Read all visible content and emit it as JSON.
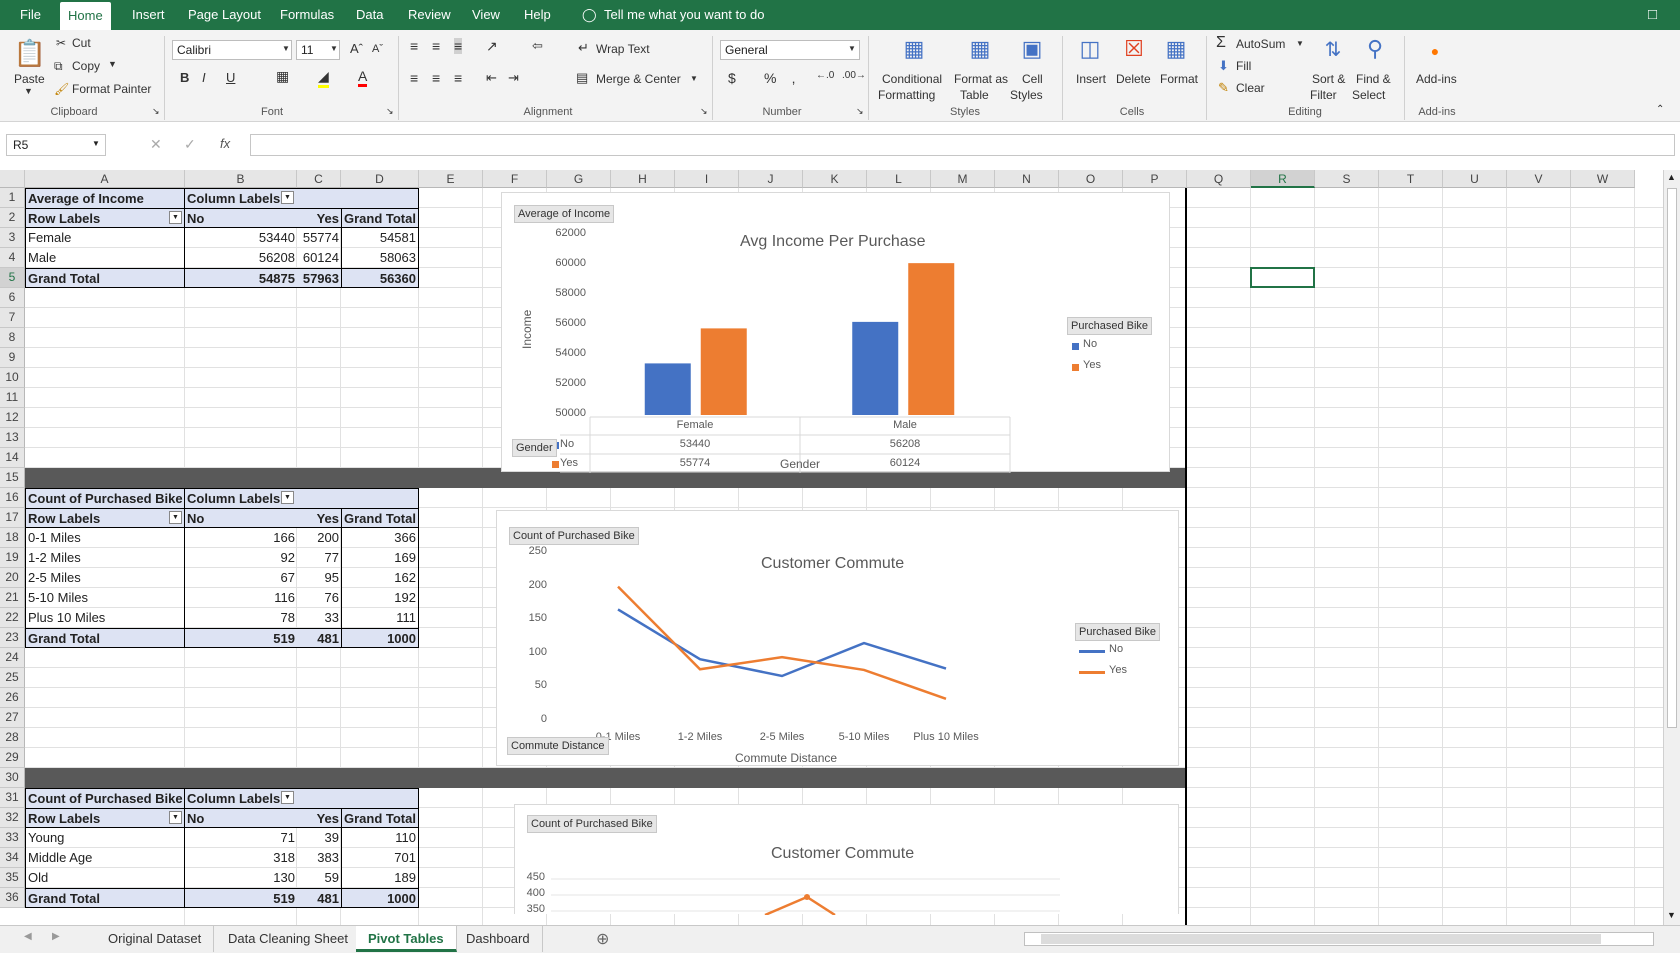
{
  "menu": {
    "items": [
      "File",
      "Home",
      "Insert",
      "Page Layout",
      "Formulas",
      "Data",
      "Review",
      "View",
      "Help"
    ],
    "tell_me": "Tell me what you want to do"
  },
  "ribbon": {
    "clipboard": {
      "paste": "Paste",
      "cut": "Cut",
      "copy": "Copy",
      "format_painter": "Format Painter",
      "group": "Clipboard"
    },
    "font": {
      "family": "Calibri",
      "size": "11",
      "group": "Font"
    },
    "alignment": {
      "wrap": "Wrap Text",
      "merge": "Merge & Center",
      "group": "Alignment"
    },
    "number": {
      "format": "General",
      "group": "Number"
    },
    "styles": {
      "conditional": "Conditional",
      "conditional2": "Formatting",
      "format_as": "Format as",
      "format_as2": "Table",
      "cell": "Cell",
      "cell2": "Styles",
      "group": "Styles"
    },
    "cells": {
      "insert": "Insert",
      "delete": "Delete",
      "format": "Format",
      "group": "Cells"
    },
    "editing": {
      "autosum": "AutoSum",
      "fill": "Fill",
      "clear": "Clear",
      "sort": "Sort &",
      "sort2": "Filter",
      "find": "Find &",
      "find2": "Select",
      "group": "Editing"
    },
    "addins": {
      "label": "Add-ins",
      "group": "Add-ins"
    }
  },
  "name_box": "R5",
  "columns": [
    "A",
    "B",
    "C",
    "D",
    "E",
    "F",
    "G",
    "H",
    "I",
    "J",
    "K",
    "L",
    "M",
    "N",
    "O",
    "P",
    "Q",
    "R",
    "S",
    "T",
    "U",
    "V",
    "W"
  ],
  "rows": [
    "1",
    "2",
    "3",
    "4",
    "5",
    "6",
    "7",
    "8",
    "9",
    "10",
    "11",
    "12",
    "13",
    "14",
    "15",
    "16",
    "17",
    "18",
    "19",
    "20",
    "21",
    "22",
    "23",
    "24",
    "25",
    "26",
    "27",
    "28",
    "29",
    "30",
    "31",
    "32",
    "33",
    "34",
    "35",
    "36"
  ],
  "pivot1": {
    "title": "Average of Income",
    "col_labels": "Column Labels",
    "row_labels": "Row Labels",
    "heads": [
      "No",
      "Yes",
      "Grand Total"
    ],
    "rows": [
      [
        "Female",
        "53440",
        "55774",
        "54581"
      ],
      [
        "Male",
        "56208",
        "60124",
        "58063"
      ]
    ],
    "total": [
      "Grand Total",
      "54875",
      "57963",
      "56360"
    ]
  },
  "pivot2": {
    "title": "Count of Purchased Bike",
    "col_labels": "Column Labels",
    "row_labels": "Row Labels",
    "heads": [
      "No",
      "Yes",
      "Grand Total"
    ],
    "rows": [
      [
        "0-1 Miles",
        "166",
        "200",
        "366"
      ],
      [
        "1-2 Miles",
        "92",
        "77",
        "169"
      ],
      [
        "2-5 Miles",
        "67",
        "95",
        "162"
      ],
      [
        "5-10 Miles",
        "116",
        "76",
        "192"
      ],
      [
        "Plus 10 Miles",
        "78",
        "33",
        "111"
      ]
    ],
    "total": [
      "Grand Total",
      "519",
      "481",
      "1000"
    ]
  },
  "pivot3": {
    "title": "Count of Purchased Bike",
    "col_labels": "Column Labels",
    "row_labels": "Row Labels",
    "heads": [
      "No",
      "Yes",
      "Grand Total"
    ],
    "rows": [
      [
        "Young",
        "71",
        "39",
        "110"
      ],
      [
        "Middle Age",
        "318",
        "383",
        "701"
      ],
      [
        "Old",
        "130",
        "59",
        "189"
      ]
    ],
    "total": [
      "Grand Total",
      "519",
      "481",
      "1000"
    ]
  },
  "chart_data": [
    {
      "type": "bar",
      "title": "Avg Income Per Purchase",
      "field_button": "Average of Income",
      "xlabel": "Gender",
      "ylabel": "Income",
      "ylim": [
        50000,
        62000
      ],
      "yticks": [
        "62000",
        "60000",
        "58000",
        "56000",
        "54000",
        "52000",
        "50000"
      ],
      "categories": [
        "Female",
        "Male"
      ],
      "series": [
        {
          "name": "No",
          "values": [
            53440,
            56208
          ],
          "color": "#4472c4"
        },
        {
          "name": "Yes",
          "values": [
            55774,
            60124
          ],
          "color": "#ed7d31"
        }
      ],
      "legend_title": "Purchased Bike",
      "axis_button": "Gender"
    },
    {
      "type": "line",
      "title": "Customer Commute",
      "field_button": "Count of Purchased Bike",
      "xlabel": "Commute Distance",
      "ylim": [
        0,
        250
      ],
      "yticks": [
        "250",
        "200",
        "150",
        "100",
        "50",
        "0"
      ],
      "categories": [
        "0-1 Miles",
        "1-2 Miles",
        "2-5 Miles",
        "5-10 Miles",
        "Plus 10 Miles"
      ],
      "series": [
        {
          "name": "No",
          "values": [
            166,
            92,
            67,
            116,
            78
          ],
          "color": "#4472c4"
        },
        {
          "name": "Yes",
          "values": [
            200,
            77,
            95,
            76,
            33
          ],
          "color": "#ed7d31"
        }
      ],
      "legend_title": "Purchased Bike",
      "axis_button": "Commute Distance"
    },
    {
      "type": "line",
      "title": "Customer Commute",
      "field_button": "Count of Purchased Bike",
      "yticks": [
        "450",
        "400",
        "350"
      ]
    }
  ],
  "sheets": [
    "Original Dataset",
    "Data Cleaning Sheet",
    "Pivot Tables",
    "Dashboard"
  ],
  "active_sheet": "Pivot Tables"
}
